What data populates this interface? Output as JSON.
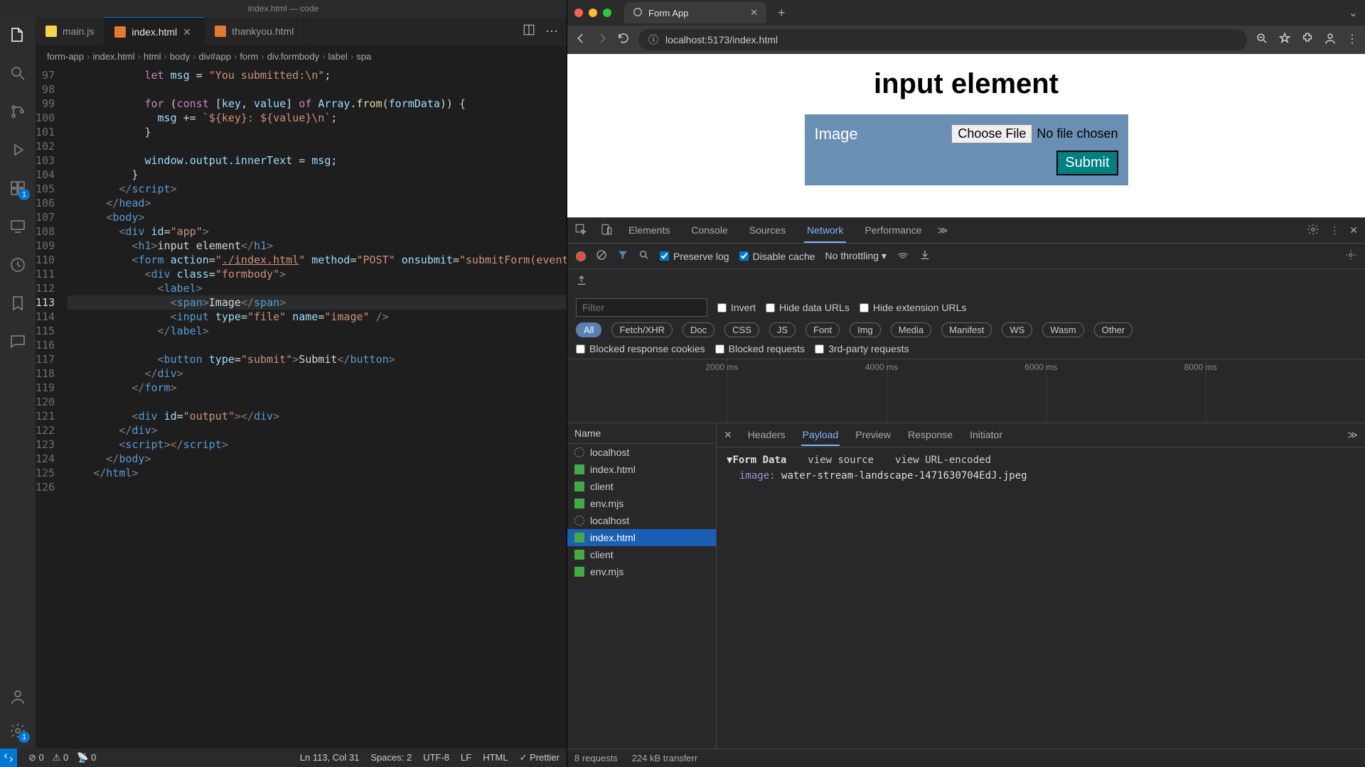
{
  "editor": {
    "title": "index.html — code",
    "tabs": [
      {
        "label": "main.js",
        "kind": "js"
      },
      {
        "label": "index.html",
        "kind": "html",
        "active": true
      },
      {
        "label": "thankyou.html",
        "kind": "html"
      }
    ],
    "breadcrumbs": [
      "form-app",
      "index.html",
      "html",
      "body",
      "div#app",
      "form",
      "div.formbody",
      "label",
      "spa"
    ],
    "active_line": 113,
    "lines": [
      {
        "n": 97,
        "html": "            <span class='tk-kw'>let</span> <span class='tk-var'>msg</span> = <span class='tk-str'>\"You submitted:\\n\"</span>;"
      },
      {
        "n": 98,
        "html": ""
      },
      {
        "n": 99,
        "html": "            <span class='tk-kw'>for</span> (<span class='tk-kw'>const</span> [<span class='tk-var'>key</span>, <span class='tk-var'>value</span>] <span class='tk-kw'>of</span> <span class='tk-var'>Array</span>.<span class='tk-fn'>from</span>(<span class='tk-var'>formData</span>)) {"
      },
      {
        "n": 100,
        "html": "              <span class='tk-var'>msg</span> += <span class='tk-str'>`${key}: ${value}\\n`</span>;"
      },
      {
        "n": 101,
        "html": "            }"
      },
      {
        "n": 102,
        "html": ""
      },
      {
        "n": 103,
        "html": "            <span class='tk-var'>window</span>.<span class='tk-var'>output</span>.<span class='tk-var'>innerText</span> = <span class='tk-var'>msg</span>;"
      },
      {
        "n": 104,
        "html": "          }"
      },
      {
        "n": 105,
        "html": "        <span class='tk-pun'>&lt;/</span><span class='tk-tag'>script</span><span class='tk-pun'>&gt;</span>"
      },
      {
        "n": 106,
        "html": "      <span class='tk-pun'>&lt;/</span><span class='tk-tag'>head</span><span class='tk-pun'>&gt;</span>"
      },
      {
        "n": 107,
        "html": "      <span class='tk-pun'>&lt;</span><span class='tk-tag'>body</span><span class='tk-pun'>&gt;</span>"
      },
      {
        "n": 108,
        "html": "        <span class='tk-pun'>&lt;</span><span class='tk-tag'>div</span> <span class='tk-attr'>id</span>=<span class='tk-str'>\"app\"</span><span class='tk-pun'>&gt;</span>"
      },
      {
        "n": 109,
        "html": "          <span class='tk-pun'>&lt;</span><span class='tk-tag'>h1</span><span class='tk-pun'>&gt;</span><span class='tk-txt'>input element</span><span class='tk-pun'>&lt;/</span><span class='tk-tag'>h1</span><span class='tk-pun'>&gt;</span>"
      },
      {
        "n": 110,
        "html": "          <span class='tk-pun'>&lt;</span><span class='tk-tag'>form</span> <span class='tk-attr'>action</span>=<span class='tk-str'>\"<u>./index.html</u>\"</span> <span class='tk-attr'>method</span>=<span class='tk-str'>\"POST\"</span> <span class='tk-attr'>onsubmit</span>=<span class='tk-str'>\"submitForm(event)\"</span><span class='tk-pun'>&gt;</span>"
      },
      {
        "n": 111,
        "html": "            <span class='tk-pun'>&lt;</span><span class='tk-tag'>div</span> <span class='tk-attr'>class</span>=<span class='tk-str'>\"formbody\"</span><span class='tk-pun'>&gt;</span>"
      },
      {
        "n": 112,
        "html": "              <span class='tk-pun'>&lt;</span><span class='tk-tag'>label</span><span class='tk-pun'>&gt;</span>"
      },
      {
        "n": 113,
        "html": "                <span class='tk-pun'>&lt;</span><span class='tk-tag'>span</span><span class='tk-pun'>&gt;</span><span class='tk-txt'>Image</span><span class='tk-pun'>&lt;/</span><span class='tk-tag'>span</span><span class='tk-pun'>&gt;</span>"
      },
      {
        "n": 114,
        "html": "                <span class='tk-pun'>&lt;</span><span class='tk-tag'>input</span> <span class='tk-attr'>type</span>=<span class='tk-str'>\"file\"</span> <span class='tk-attr'>name</span>=<span class='tk-str'>\"image\"</span> <span class='tk-pun'>/&gt;</span>"
      },
      {
        "n": 115,
        "html": "              <span class='tk-pun'>&lt;/</span><span class='tk-tag'>label</span><span class='tk-pun'>&gt;</span>"
      },
      {
        "n": 116,
        "html": ""
      },
      {
        "n": 117,
        "html": "              <span class='tk-pun'>&lt;</span><span class='tk-tag'>button</span> <span class='tk-attr'>type</span>=<span class='tk-str'>\"submit\"</span><span class='tk-pun'>&gt;</span><span class='tk-txt'>Submit</span><span class='tk-pun'>&lt;/</span><span class='tk-tag'>button</span><span class='tk-pun'>&gt;</span>"
      },
      {
        "n": 118,
        "html": "            <span class='tk-pun'>&lt;/</span><span class='tk-tag'>div</span><span class='tk-pun'>&gt;</span>"
      },
      {
        "n": 119,
        "html": "          <span class='tk-pun'>&lt;/</span><span class='tk-tag'>form</span><span class='tk-pun'>&gt;</span>"
      },
      {
        "n": 120,
        "html": ""
      },
      {
        "n": 121,
        "html": "          <span class='tk-pun'>&lt;</span><span class='tk-tag'>div</span> <span class='tk-attr'>id</span>=<span class='tk-str'>\"output\"</span><span class='tk-pun'>&gt;&lt;/</span><span class='tk-tag'>div</span><span class='tk-pun'>&gt;</span>"
      },
      {
        "n": 122,
        "html": "        <span class='tk-pun'>&lt;/</span><span class='tk-tag'>div</span><span class='tk-pun'>&gt;</span>"
      },
      {
        "n": 123,
        "html": "        <span class='tk-pun'>&lt;</span><span class='tk-tag'>script</span><span class='tk-pun'>&gt;&lt;/</span><span class='tk-tag'>script</span><span class='tk-pun'>&gt;</span>"
      },
      {
        "n": 124,
        "html": "      <span class='tk-pun'>&lt;/</span><span class='tk-tag'>body</span><span class='tk-pun'>&gt;</span>"
      },
      {
        "n": 125,
        "html": "    <span class='tk-pun'>&lt;/</span><span class='tk-tag'>html</span><span class='tk-pun'>&gt;</span>"
      },
      {
        "n": 126,
        "html": ""
      }
    ],
    "status": {
      "errors": "0",
      "warnings": "0",
      "ports": "0",
      "cursor": "Ln 113, Col 31",
      "spaces": "Spaces: 2",
      "encoding": "UTF-8",
      "eol": "LF",
      "lang": "HTML",
      "prettier": "✓ Prettier"
    }
  },
  "browser": {
    "tab_title": "Form App",
    "url": "localhost:5173/index.html",
    "page": {
      "heading": "input element",
      "label": "Image",
      "choose_file": "Choose File",
      "no_file": "No file chosen",
      "submit": "Submit"
    }
  },
  "devtools": {
    "tabs": [
      "Elements",
      "Console",
      "Sources",
      "Network",
      "Performance"
    ],
    "active_tab": "Network",
    "toolbar": {
      "preserve_log": "Preserve log",
      "disable_cache": "Disable cache",
      "throttling": "No throttling"
    },
    "filter": {
      "placeholder": "Filter",
      "invert": "Invert",
      "hide_data": "Hide data URLs",
      "hide_ext": "Hide extension URLs",
      "types": [
        "All",
        "Fetch/XHR",
        "Doc",
        "CSS",
        "JS",
        "Font",
        "Img",
        "Media",
        "Manifest",
        "WS",
        "Wasm",
        "Other"
      ],
      "blocked_cookies": "Blocked response cookies",
      "blocked_req": "Blocked requests",
      "third_party": "3rd-party requests"
    },
    "timeline_ticks": [
      "2000 ms",
      "4000 ms",
      "6000 ms",
      "8000 ms"
    ],
    "reqlist": {
      "header": "Name",
      "items": [
        {
          "name": "localhost",
          "kind": "ws"
        },
        {
          "name": "index.html",
          "kind": "doc"
        },
        {
          "name": "client",
          "kind": "doc"
        },
        {
          "name": "env.mjs",
          "kind": "doc"
        },
        {
          "name": "localhost",
          "kind": "ws"
        },
        {
          "name": "index.html",
          "kind": "doc",
          "selected": true
        },
        {
          "name": "client",
          "kind": "doc"
        },
        {
          "name": "env.mjs",
          "kind": "doc"
        }
      ]
    },
    "detail": {
      "tabs": [
        "Headers",
        "Payload",
        "Preview",
        "Response",
        "Initiator"
      ],
      "active": "Payload",
      "form_data_label": "Form Data",
      "view_source": "view source",
      "view_url": "view URL-encoded",
      "payload_key": "image:",
      "payload_val": "water-stream-landscape-1471630704EdJ.jpeg"
    },
    "status": {
      "requests": "8 requests",
      "transferred": "224 kB transferr"
    }
  }
}
